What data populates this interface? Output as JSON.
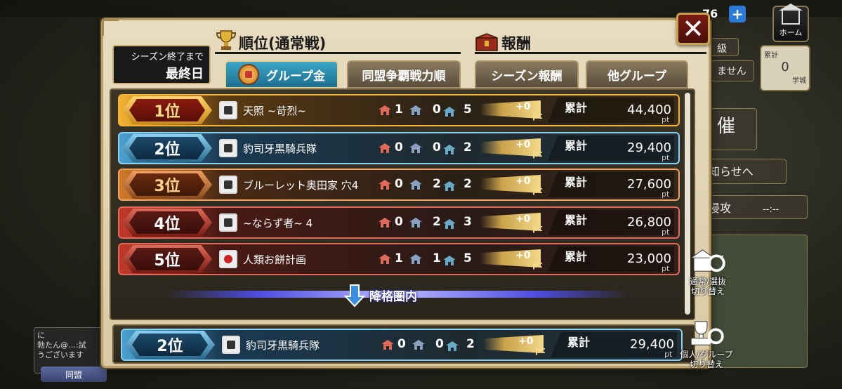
{
  "background": {
    "coins": "76",
    "home_label": "ホーム",
    "card_right_1": "ません",
    "card_right_2": "催",
    "card_right_3": "知らせへ",
    "card_right_4": "侵攻",
    "card_right_4_time": "--:--",
    "side_card_top": "累計",
    "side_card_val": "0",
    "side_card_unit": "学城",
    "side_level": "級",
    "chat_line1": "に",
    "chat_line2": "勃たん@…:試",
    "chat_line3": "うございます",
    "alliance_button": "同盟"
  },
  "panel": {
    "season_label": "シーズン終了まで",
    "season_value": "最終日",
    "ranking_title": "順位(通常戦)",
    "reward_title": "報酬",
    "close_label": "✕"
  },
  "tabs": [
    {
      "label": "グループ金",
      "active": true
    },
    {
      "label": "同盟争覇戦力順",
      "active": false
    },
    {
      "label": "シーズン報酬",
      "active": false
    },
    {
      "label": "他グループ",
      "active": false
    }
  ],
  "rows": [
    {
      "rank": "1位",
      "name": "天照 ~苛烈~",
      "c1": "1",
      "c2": "0",
      "c3": "5",
      "pt": "+0",
      "pt_unit": "pt",
      "sum_label": "累計",
      "sum": "44,400",
      "sum_unit": "pt",
      "color": "gold"
    },
    {
      "rank": "2位",
      "name": "豹司牙黒騎兵隊",
      "c1": "0",
      "c2": "0",
      "c3": "2",
      "pt": "+0",
      "pt_unit": "pt",
      "sum_label": "累計",
      "sum": "29,400",
      "sum_unit": "pt",
      "color": "blue"
    },
    {
      "rank": "3位",
      "name": "ブルーレット奥田家 穴4",
      "c1": "0",
      "c2": "2",
      "c3": "2",
      "pt": "+0",
      "pt_unit": "pt",
      "sum_label": "累計",
      "sum": "27,600",
      "sum_unit": "pt",
      "color": "bronze"
    },
    {
      "rank": "4位",
      "name": "~ならず者~ 4",
      "c1": "0",
      "c2": "2",
      "c3": "3",
      "pt": "+0",
      "pt_unit": "pt",
      "sum_label": "累計",
      "sum": "26,800",
      "sum_unit": "pt",
      "color": "red"
    },
    {
      "rank": "5位",
      "name": "人類お餅計画",
      "c1": "1",
      "c2": "1",
      "c3": "5",
      "pt": "+0",
      "pt_unit": "pt",
      "sum_label": "累計",
      "sum": "23,000",
      "sum_unit": "pt",
      "color": "red"
    }
  ],
  "demotion_label": "降格圏内",
  "own_row": {
    "rank": "2位",
    "name": "豹司牙黒騎兵隊",
    "c1": "0",
    "c2": "0",
    "c3": "2",
    "pt": "+0",
    "pt_unit": "pt",
    "sum_label": "累計",
    "sum": "29,400",
    "sum_unit": "pt"
  },
  "side_buttons": {
    "switch_mode_1": "通常/選抜",
    "switch_mode_2": "切り替え",
    "switch_group_1": "個人/グループ",
    "switch_group_2": "切り替え"
  },
  "colors": {
    "gold": "#f2b233",
    "blue": "#4aa0d0",
    "bronze": "#d07a2a",
    "red": "#c23a2a",
    "panel_bg": "#e8dcc0",
    "active_tab": "#3aa7c8"
  }
}
